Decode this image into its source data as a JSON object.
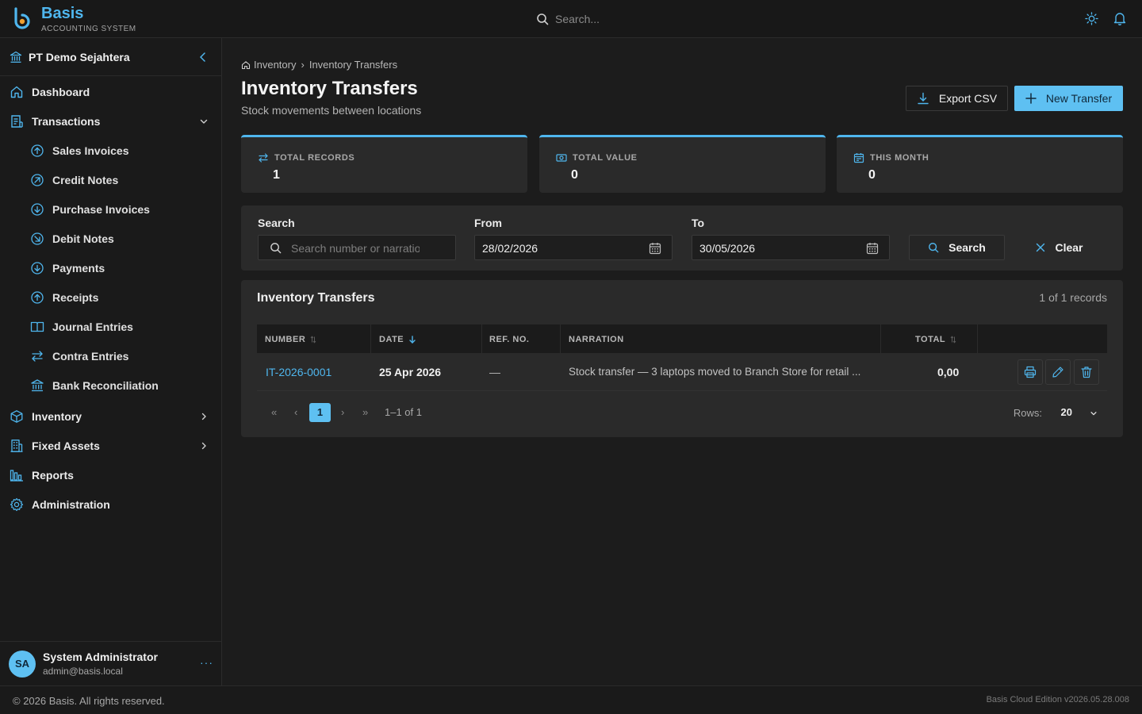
{
  "app": {
    "name": "Basis",
    "subtitle": "ACCOUNTING SYSTEM",
    "search_placeholder": "Search...",
    "accent": "#4fb6ee",
    "primary_button": "#5ec0f2"
  },
  "sidebar": {
    "org_name": "PT Demo Sejahtera",
    "items": [
      {
        "label": "Dashboard",
        "icon": "home-icon"
      },
      {
        "label": "Transactions",
        "icon": "receipt-icon",
        "expanded": true
      },
      {
        "label": "Sales Invoices",
        "icon": "circle-arrow-up-icon"
      },
      {
        "label": "Credit Notes",
        "icon": "circle-arrow-up-right-icon"
      },
      {
        "label": "Purchase Invoices",
        "icon": "circle-arrow-down-icon"
      },
      {
        "label": "Debit Notes",
        "icon": "circle-arrow-down-right-icon"
      },
      {
        "label": "Payments",
        "icon": "circle-arrow-down-icon"
      },
      {
        "label": "Receipts",
        "icon": "circle-arrow-up-icon"
      },
      {
        "label": "Journal Entries",
        "icon": "book-icon"
      },
      {
        "label": "Contra Entries",
        "icon": "arrows-swap-icon"
      },
      {
        "label": "Bank Reconciliation",
        "icon": "bank-icon"
      },
      {
        "label": "Inventory",
        "icon": "box-icon"
      },
      {
        "label": "Fixed Assets",
        "icon": "building-icon"
      },
      {
        "label": "Reports",
        "icon": "bar-chart-icon"
      },
      {
        "label": "Administration",
        "icon": "gear-icon"
      }
    ]
  },
  "user": {
    "initials": "SA",
    "name": "System Administrator",
    "email": "admin@basis.local",
    "more": "···"
  },
  "breadcrumb": {
    "parent": "Inventory",
    "separator": "›",
    "current": "Inventory Transfers"
  },
  "page": {
    "title": "Inventory Transfers",
    "subtitle": "Stock movements between locations",
    "export_label": "Export CSV",
    "new_label": "New Transfer"
  },
  "stats": [
    {
      "label": "TOTAL RECORDS",
      "value": "1",
      "icon": "swap-icon"
    },
    {
      "label": "TOTAL VALUE",
      "value": "0",
      "icon": "cash-icon"
    },
    {
      "label": "THIS MONTH",
      "value": "0",
      "icon": "calendar-icon"
    }
  ],
  "filters": {
    "search_label": "Search",
    "search_placeholder": "Search number or narration",
    "from_label": "From",
    "from_value": "28/02/2026",
    "to_label": "To",
    "to_value": "30/05/2026",
    "search_button": "Search",
    "clear_button": "Clear"
  },
  "table": {
    "title": "Inventory Transfers",
    "count": "1 of 1 records",
    "columns": [
      "NUMBER",
      "DATE",
      "REF. NO.",
      "NARRATION",
      "TOTAL"
    ],
    "rows": [
      {
        "number": "IT-2026-0001",
        "date": "25 Apr 2026",
        "ref": "—",
        "narration": "Stock transfer — 3 laptops moved to Branch Store for retail ...",
        "total": "0,00"
      }
    ]
  },
  "pagination": {
    "first": "«",
    "prev": "‹",
    "current_page": "1",
    "next": "›",
    "last": "»",
    "range": "1–1 of 1",
    "rows_label": "Rows:",
    "rows_value": "20"
  },
  "footer": {
    "copyright": "© 2026 Basis. All rights reserved.",
    "version": "Basis Cloud Edition v2026.05.28.008"
  }
}
